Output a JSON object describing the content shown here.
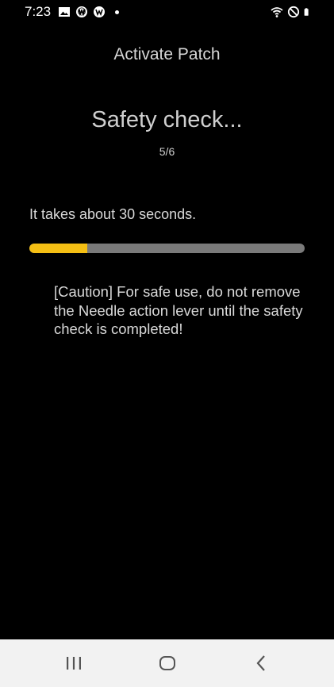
{
  "status_bar": {
    "time": "7:23",
    "left_icons": [
      "gallery-icon",
      "app-icon",
      "app-icon",
      "notification-dot"
    ],
    "right_icons": [
      "wifi-icon",
      "do-not-disturb-icon",
      "battery-icon"
    ]
  },
  "header": {
    "title": "Activate Patch"
  },
  "main": {
    "title": "Safety check...",
    "step": "5/6",
    "duration": "It takes about 30 seconds.",
    "progress_percent": 21,
    "caution": "[Caution] For safe use, do not remove the Needle action lever until the safety check is completed!"
  },
  "colors": {
    "background": "#000000",
    "progress_fill": "#f5bf14",
    "progress_track": "#7a7a7a",
    "nav_bar": "#f2f2f2"
  },
  "nav_bar": {
    "buttons": [
      "recents-icon",
      "home-icon",
      "back-icon"
    ]
  }
}
